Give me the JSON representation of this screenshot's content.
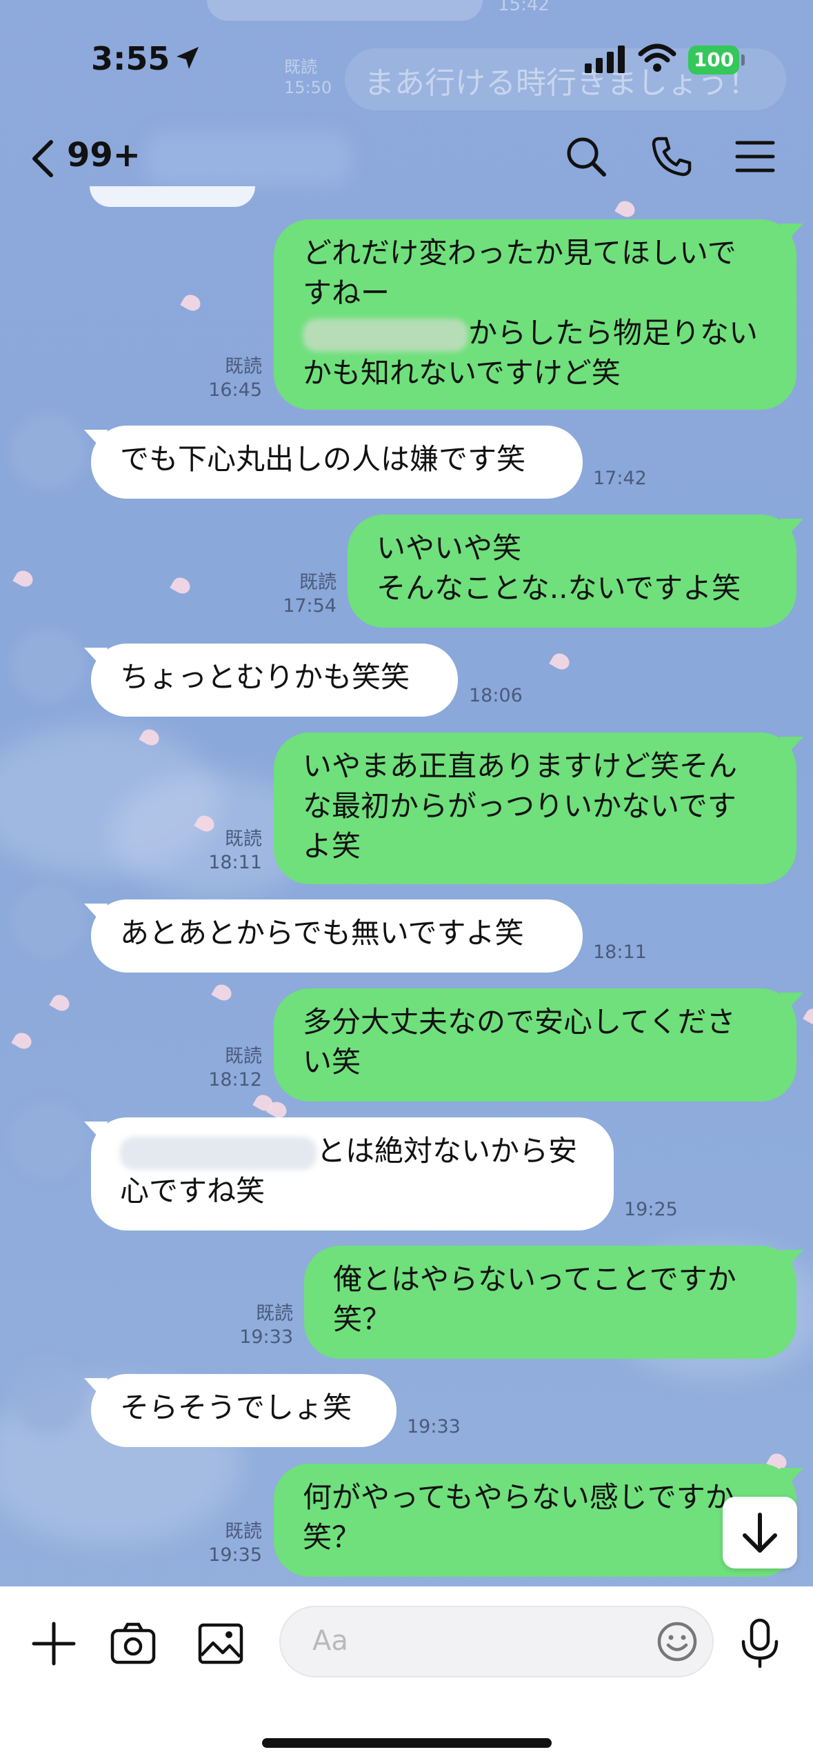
{
  "status": {
    "time": "3:55",
    "battery": "100"
  },
  "ghost": {
    "top_time": "15:42",
    "read": "既読",
    "time": "15:50",
    "message": "まあ行ける時行きましょう！"
  },
  "header": {
    "unread_count": "99+"
  },
  "messages": [
    {
      "lines": [
        "どれだけ変わったか見てほしいで",
        "すねー",
        "からしたら物足りない",
        "かも知れないですけど笑"
      ],
      "read": "既読",
      "time": "16:45"
    },
    {
      "text": "でも下心丸出しの人は嫌です笑",
      "time": "17:42"
    },
    {
      "lines": [
        "いやいや笑",
        "そんなことな..ないですよ笑"
      ],
      "read": "既読",
      "time": "17:54"
    },
    {
      "text": "ちょっとむりかも笑笑",
      "time": "18:06"
    },
    {
      "lines": [
        "いやまあ正直ありますけど笑そん",
        "な最初からがっつりいかないです",
        "よ笑"
      ],
      "read": "既読",
      "time": "18:11"
    },
    {
      "text": "あとあとからでも無いですよ笑",
      "time": "18:11"
    },
    {
      "lines": [
        "多分大丈夫なので安心してくださ",
        "い笑"
      ],
      "read": "既読",
      "time": "18:12"
    },
    {
      "lines": [
        "とは絶対ないから安",
        "心ですね笑"
      ],
      "time": "19:25"
    },
    {
      "lines": [
        "俺とはやらないってことですか",
        "笑？"
      ],
      "read": "既読",
      "time": "19:33"
    },
    {
      "text": "そらそうでしょ笑",
      "time": "19:33"
    },
    {
      "lines": [
        "何がやってもやらない感じですか",
        "笑？"
      ],
      "read": "既読",
      "time": "19:35"
    }
  ],
  "composer": {
    "placeholder": "Aa"
  },
  "icons": [
    "location-arrow-icon",
    "signal-icon",
    "wifi-icon",
    "back-chevron-icon",
    "search-icon",
    "phone-icon",
    "menu-icon",
    "plus-icon",
    "camera-icon",
    "image-icon",
    "emoji-icon",
    "mic-icon",
    "arrow-down-icon"
  ],
  "colors": {
    "my_bubble": "#6fe07b",
    "their_bubble": "#ffffff",
    "background": "#8ea9db"
  }
}
